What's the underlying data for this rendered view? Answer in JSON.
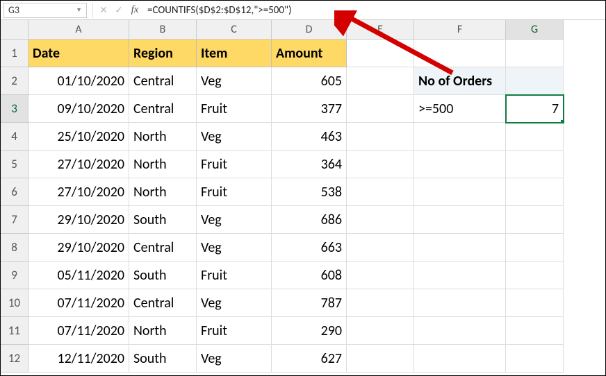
{
  "nameBox": "G3",
  "formula": "=COUNTIFS($D$2:$D$12,\">=500\")",
  "columns": [
    "A",
    "B",
    "C",
    "D",
    "E",
    "F",
    "G"
  ],
  "rowNums": [
    "1",
    "2",
    "3",
    "4",
    "5",
    "6",
    "7",
    "8",
    "9",
    "10",
    "11",
    "12"
  ],
  "headers": {
    "A": "Date",
    "B": "Region",
    "C": "Item",
    "D": "Amount"
  },
  "summary": {
    "label": "No of Orders",
    "criteria": ">=500",
    "result": "7"
  },
  "rows": [
    {
      "date": "01/10/2020",
      "region": "Central",
      "item": "Veg",
      "amount": "605"
    },
    {
      "date": "09/10/2020",
      "region": "Central",
      "item": "Fruit",
      "amount": "377"
    },
    {
      "date": "25/10/2020",
      "region": "North",
      "item": "Veg",
      "amount": "463"
    },
    {
      "date": "27/10/2020",
      "region": "North",
      "item": "Fruit",
      "amount": "364"
    },
    {
      "date": "27/10/2020",
      "region": "North",
      "item": "Fruit",
      "amount": "538"
    },
    {
      "date": "29/10/2020",
      "region": "South",
      "item": "Veg",
      "amount": "686"
    },
    {
      "date": "29/10/2020",
      "region": "Central",
      "item": "Veg",
      "amount": "663"
    },
    {
      "date": "05/11/2020",
      "region": "South",
      "item": "Fruit",
      "amount": "608"
    },
    {
      "date": "07/11/2020",
      "region": "Central",
      "item": "Veg",
      "amount": "787"
    },
    {
      "date": "07/11/2020",
      "region": "North",
      "item": "Fruit",
      "amount": "290"
    },
    {
      "date": "12/11/2020",
      "region": "South",
      "item": "Veg",
      "amount": "627"
    }
  ],
  "chart_data": {
    "type": "table",
    "title": "",
    "columns": [
      "Date",
      "Region",
      "Item",
      "Amount"
    ],
    "rows": [
      [
        "01/10/2020",
        "Central",
        "Veg",
        605
      ],
      [
        "09/10/2020",
        "Central",
        "Fruit",
        377
      ],
      [
        "25/10/2020",
        "North",
        "Veg",
        463
      ],
      [
        "27/10/2020",
        "North",
        "Fruit",
        364
      ],
      [
        "27/10/2020",
        "North",
        "Fruit",
        538
      ],
      [
        "29/10/2020",
        "South",
        "Veg",
        686
      ],
      [
        "29/10/2020",
        "Central",
        "Veg",
        663
      ],
      [
        "05/11/2020",
        "South",
        "Fruit",
        608
      ],
      [
        "07/11/2020",
        "Central",
        "Veg",
        787
      ],
      [
        "07/11/2020",
        "North",
        "Fruit",
        290
      ],
      [
        "12/11/2020",
        "South",
        "Veg",
        627
      ]
    ],
    "summary": {
      "label": "No of Orders",
      "criteria": ">=500",
      "result": 7
    }
  }
}
